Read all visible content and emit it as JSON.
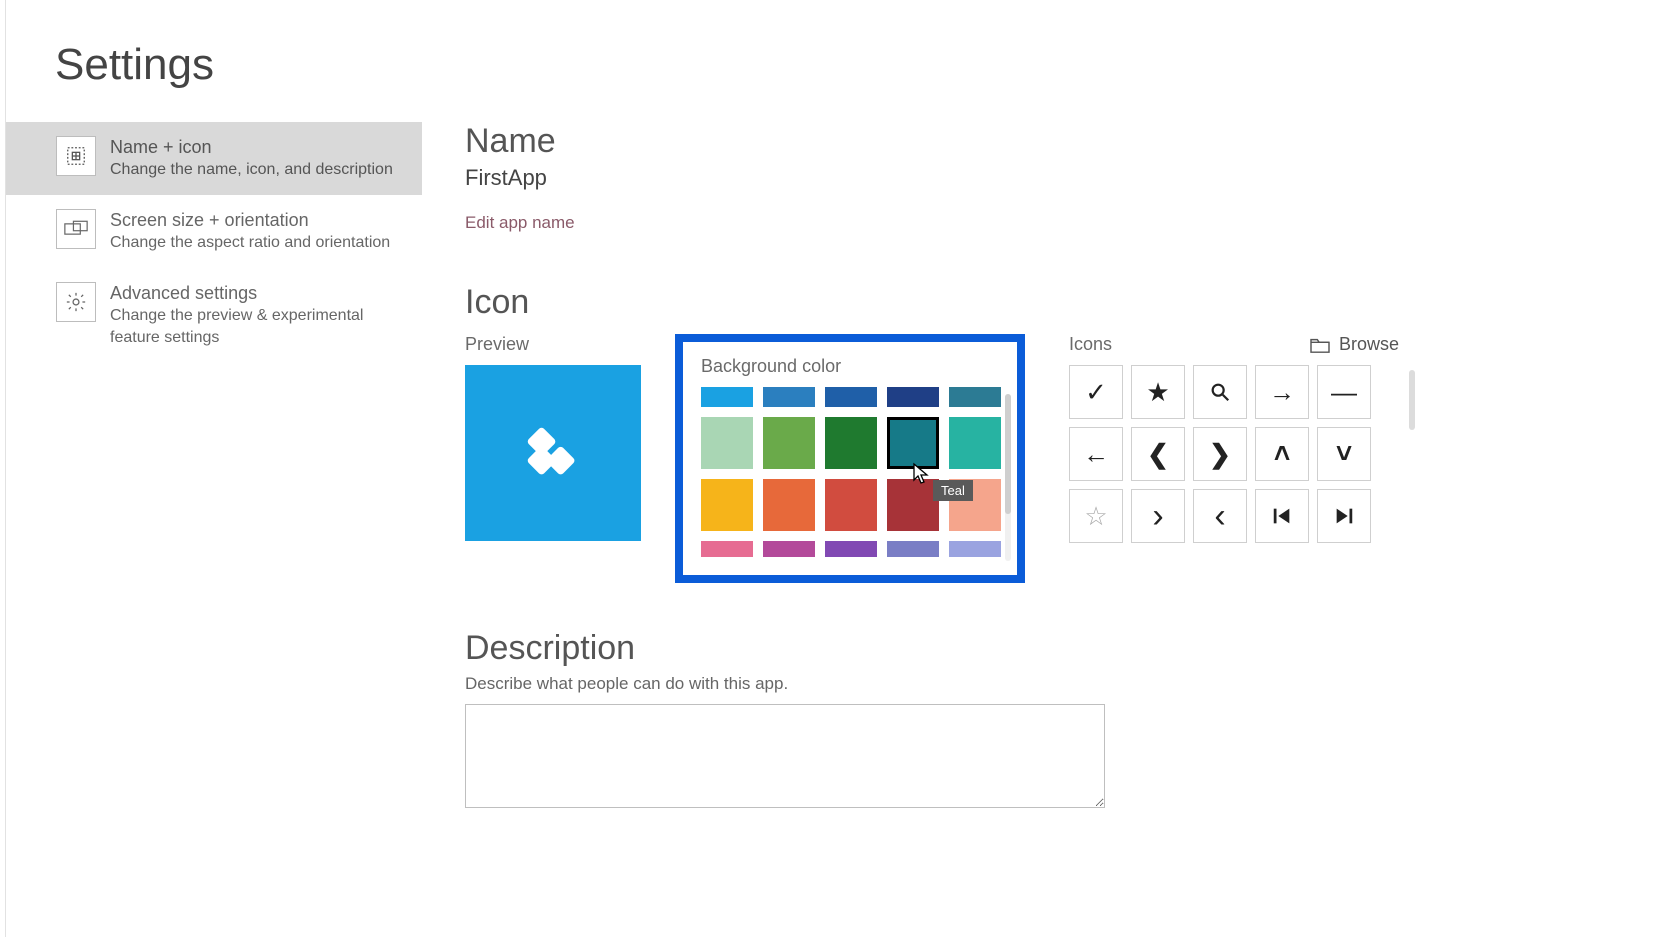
{
  "page_title": "Settings",
  "sidebar": {
    "items": [
      {
        "title": "Name + icon",
        "desc": "Change the name, icon, and description",
        "active": true
      },
      {
        "title": "Screen size + orientation",
        "desc": "Change the aspect ratio and orientation",
        "active": false
      },
      {
        "title": "Advanced settings",
        "desc": "Change the preview & experimental feature settings",
        "active": false
      }
    ]
  },
  "name_section": {
    "heading": "Name",
    "value": "FirstApp",
    "edit_link": "Edit app name"
  },
  "icon_section": {
    "heading": "Icon",
    "preview_label": "Preview",
    "bgcolor_label": "Background color",
    "icons_label": "Icons",
    "browse_label": "Browse",
    "tooltip": "Teal",
    "preview_bg": "#1aa1e2",
    "colors": [
      {
        "hex": "#1aa1e2",
        "h": "half"
      },
      {
        "hex": "#2b7fbf",
        "h": "half"
      },
      {
        "hex": "#1f5fa8",
        "h": "half"
      },
      {
        "hex": "#1f3f86",
        "h": "half"
      },
      {
        "hex": "#2c7b94",
        "h": "half"
      },
      {
        "hex": "#a9d6b4"
      },
      {
        "hex": "#6aaa4a"
      },
      {
        "hex": "#1f7a2f"
      },
      {
        "hex": "#167a88",
        "selected": true
      },
      {
        "hex": "#27b3a2"
      },
      {
        "hex": "#f6b41a"
      },
      {
        "hex": "#e7693a"
      },
      {
        "hex": "#d14c3f"
      },
      {
        "hex": "#a73338"
      },
      {
        "hex": "#f5a58c"
      },
      {
        "hex": "#e66c92",
        "h": "thin"
      },
      {
        "hex": "#b34a9a",
        "h": "thin"
      },
      {
        "hex": "#8149b3",
        "h": "thin"
      },
      {
        "hex": "#7a7ec5",
        "h": "thin"
      },
      {
        "hex": "#9aa3e0",
        "h": "thin"
      }
    ],
    "icons": [
      "check",
      "star-filled",
      "search",
      "arrow-right",
      "minus",
      "arrow-left",
      "chevron-left-bold",
      "chevron-right-bold",
      "chevron-up-bold",
      "chevron-down-bold",
      "star-outline",
      "chevron-right",
      "chevron-left",
      "skip-previous",
      "skip-next"
    ]
  },
  "description_section": {
    "heading": "Description",
    "sub": "Describe what people can do with this app.",
    "value": ""
  }
}
